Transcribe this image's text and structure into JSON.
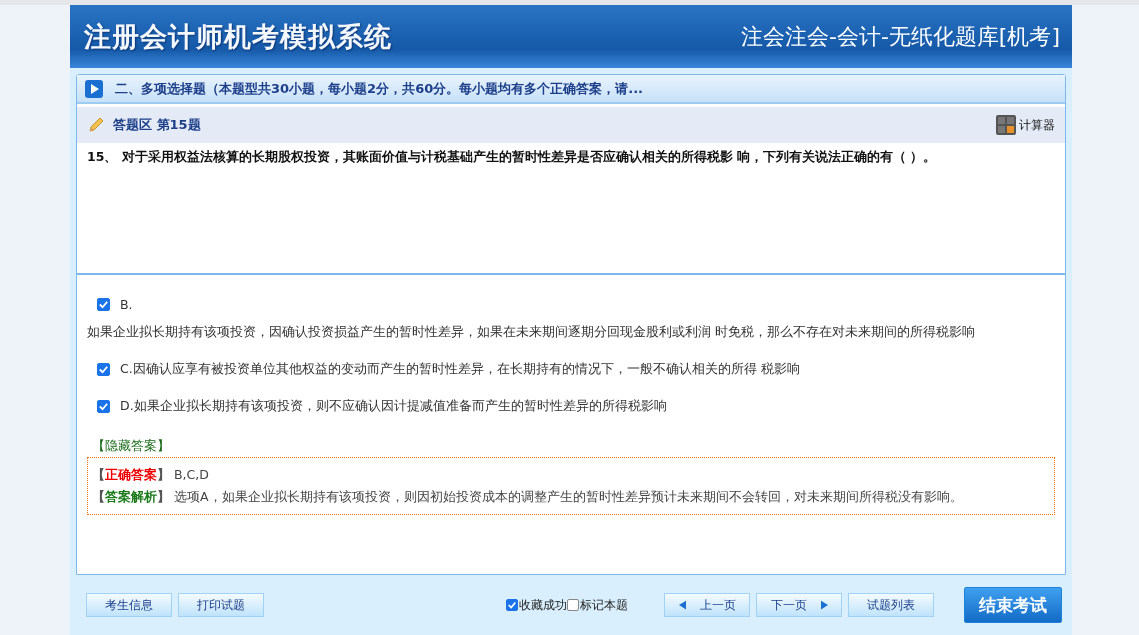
{
  "header": {
    "system_title": "注册会计师机考模拟系统",
    "bank_title": "注会注会-会计-无纸化题库[机考]"
  },
  "section": {
    "title": "二、多项选择题（本题型共30小题，每小题2分，共60分。每小题均有多个正确答案，请..."
  },
  "answer_area": {
    "title": "答题区 第15题",
    "calculator": "计算器"
  },
  "question": {
    "text": "15、 对于采用权益法核算的长期股权投资，其账面价值与计税基础产生的暂时性差异是否应确认相关的所得税影 响，下列有关说法正确的有（  ）。"
  },
  "options": [
    {
      "label": "B.",
      "text": "如果企业拟长期持有该项投资，因确认投资损益产生的暂时性差异，如果在未来期间逐期分回现金股利或利润 时免税，那么不存在对未来期间的所得税影响",
      "checked": true
    },
    {
      "label": "C.因确认应享有被投资单位其他权益的变动而产生的暂时性差异，在长期持有的情况下，一般不确认相关的所得 税影响",
      "checked": true
    },
    {
      "label": "D.如果企业拟长期持有该项投资，则不应确认因计提减值准备而产生的暂时性差异的所得税影响",
      "checked": true
    }
  ],
  "answer": {
    "toggle": "【隐藏答案】",
    "correct_label": "正确答案",
    "correct_value": "B,C,D",
    "analysis_label": "答案解析",
    "analysis_text": "选项A，如果企业拟长期持有该项投资，则因初始投资成本的调整产生的暂时性差异预计未来期间不会转回，对未来期间所得税没有影响。",
    "bracket_open": "【",
    "bracket_close": "】"
  },
  "footer": {
    "left_buttons": [
      "考生信息",
      "打印试题"
    ],
    "checks": [
      {
        "label": "收藏成功",
        "checked": true
      },
      {
        "label": "标记本题",
        "checked": false
      }
    ],
    "prev": "上一页",
    "next": "下一页",
    "list": "试题列表",
    "finish": "结束考试"
  }
}
